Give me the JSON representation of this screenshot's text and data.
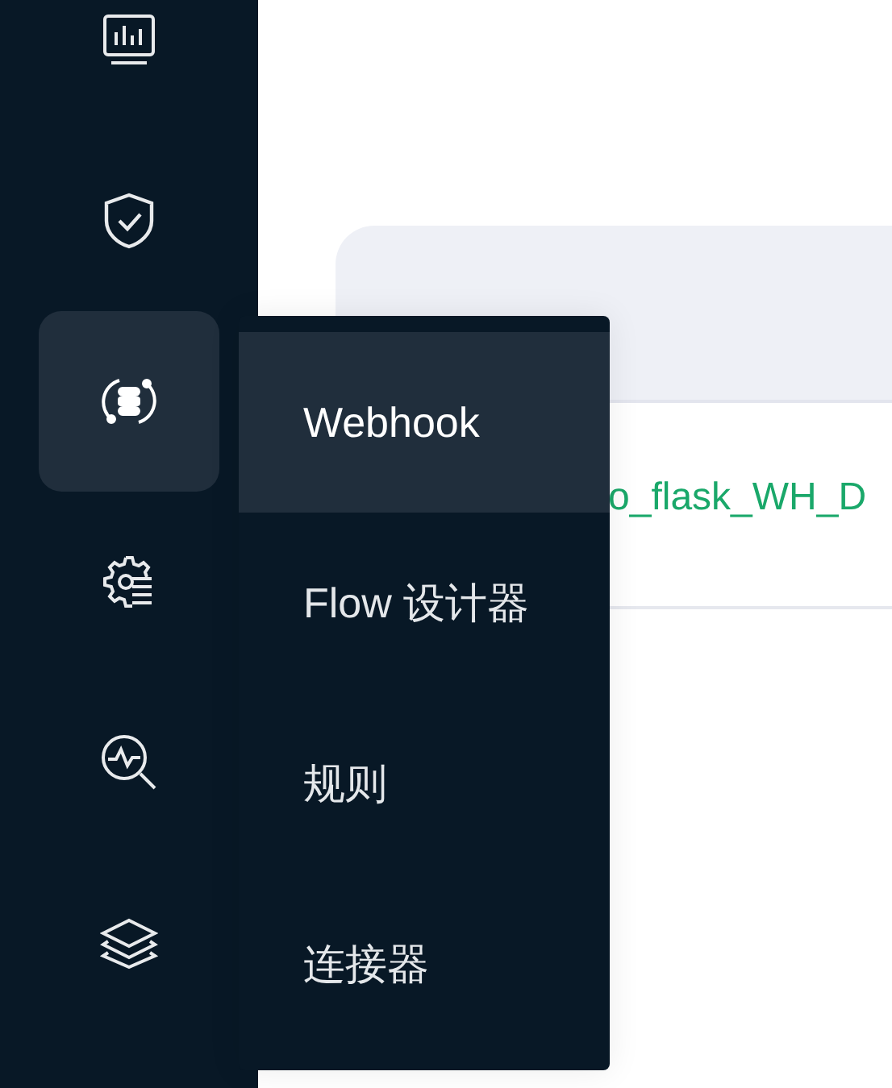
{
  "sidebar": {
    "items": [
      {
        "kind": "monitor",
        "selected": false
      },
      {
        "kind": "shield",
        "selected": false
      },
      {
        "kind": "database",
        "selected": true
      },
      {
        "kind": "gear",
        "selected": false
      },
      {
        "kind": "pulse",
        "selected": false
      },
      {
        "kind": "layers",
        "selected": false
      }
    ]
  },
  "table": {
    "rows": [
      [
        "o_flask_WH_D"
      ]
    ]
  },
  "menu": {
    "items": [
      {
        "label": "Webhook",
        "selected": true
      },
      {
        "label": "Flow 设计器",
        "selected": false
      },
      {
        "label": "规则",
        "selected": false
      },
      {
        "label": "连接器",
        "selected": false
      }
    ]
  }
}
